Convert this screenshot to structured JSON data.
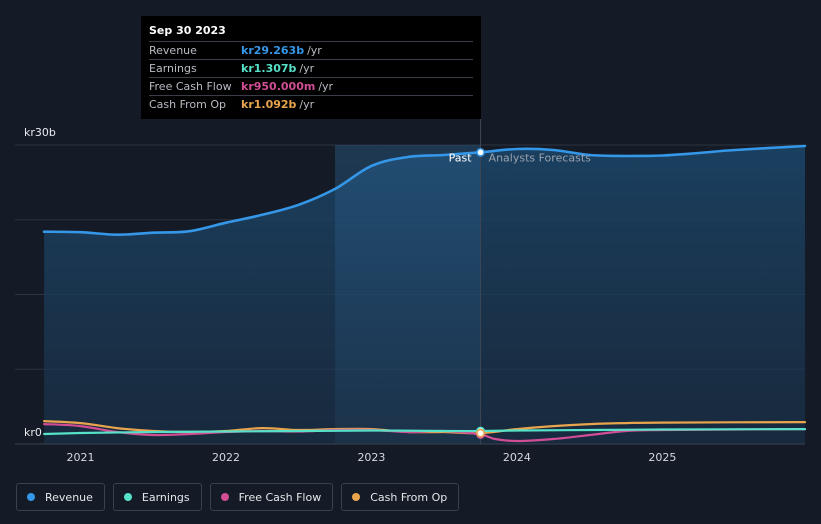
{
  "chart_data": {
    "type": "line",
    "currency_prefix": "kr",
    "y_axis": {
      "top_label": "kr30b",
      "bottom_label": "kr0",
      "ylim": [
        0,
        30
      ]
    },
    "x_ticks": [
      "2021",
      "2022",
      "2023",
      "2024",
      "2025"
    ],
    "x_tick_values": [
      2021.0,
      2022.0,
      2023.0,
      2024.0,
      2025.0
    ],
    "xlim": [
      2020.55,
      2025.98
    ],
    "past_end": 2023.75,
    "shade_start": 2022.75,
    "divider_labels": {
      "past": "Past",
      "forecast": "Analysts Forecasts"
    },
    "series": [
      {
        "name": "Revenue",
        "color": "#3597e8",
        "fill": true,
        "points": [
          [
            2020.75,
            21.3
          ],
          [
            2021.0,
            21.25
          ],
          [
            2021.25,
            21.0
          ],
          [
            2021.5,
            21.2
          ],
          [
            2021.75,
            21.35
          ],
          [
            2022.0,
            22.2
          ],
          [
            2022.25,
            23.0
          ],
          [
            2022.5,
            24.0
          ],
          [
            2022.75,
            25.6
          ],
          [
            2023.0,
            27.9
          ],
          [
            2023.25,
            28.8
          ],
          [
            2023.5,
            29.0
          ],
          [
            2023.75,
            29.263
          ],
          [
            2024.0,
            29.6
          ],
          [
            2024.25,
            29.5
          ],
          [
            2024.5,
            29.0
          ],
          [
            2024.75,
            28.9
          ],
          [
            2025.0,
            28.95
          ],
          [
            2025.25,
            29.2
          ],
          [
            2025.5,
            29.5
          ],
          [
            2025.98,
            29.9
          ]
        ]
      },
      {
        "name": "Earnings",
        "color": "#57e1c8",
        "fill": false,
        "points": [
          [
            2020.75,
            1.0
          ],
          [
            2021.0,
            1.1
          ],
          [
            2021.5,
            1.2
          ],
          [
            2022.0,
            1.25
          ],
          [
            2022.5,
            1.3
          ],
          [
            2023.0,
            1.35
          ],
          [
            2023.5,
            1.3
          ],
          [
            2023.75,
            1.307
          ],
          [
            2024.0,
            1.35
          ],
          [
            2024.5,
            1.4
          ],
          [
            2025.0,
            1.45
          ],
          [
            2025.98,
            1.5
          ]
        ]
      },
      {
        "name": "Free Cash Flow",
        "color": "#d14e94",
        "fill": false,
        "points": [
          [
            2020.75,
            2.0
          ],
          [
            2021.0,
            1.8
          ],
          [
            2021.25,
            1.2
          ],
          [
            2021.5,
            0.9
          ],
          [
            2021.75,
            1.0
          ],
          [
            2022.0,
            1.2
          ],
          [
            2022.25,
            1.3
          ],
          [
            2022.5,
            1.25
          ],
          [
            2022.75,
            1.4
          ],
          [
            2023.0,
            1.4
          ],
          [
            2023.25,
            1.2
          ],
          [
            2023.5,
            1.3
          ],
          [
            2023.75,
            0.95
          ],
          [
            2023.85,
            0.5
          ],
          [
            2024.0,
            0.3
          ],
          [
            2024.25,
            0.5
          ],
          [
            2024.5,
            0.9
          ],
          [
            2024.75,
            1.3
          ],
          [
            2025.0,
            1.4
          ],
          [
            2025.98,
            1.5
          ]
        ]
      },
      {
        "name": "Cash From Op",
        "color": "#e9a54d",
        "fill": false,
        "points": [
          [
            2020.75,
            2.3
          ],
          [
            2021.0,
            2.1
          ],
          [
            2021.25,
            1.6
          ],
          [
            2021.5,
            1.3
          ],
          [
            2021.75,
            1.2
          ],
          [
            2022.0,
            1.3
          ],
          [
            2022.25,
            1.6
          ],
          [
            2022.5,
            1.4
          ],
          [
            2022.75,
            1.5
          ],
          [
            2023.0,
            1.5
          ],
          [
            2023.25,
            1.2
          ],
          [
            2023.5,
            1.2
          ],
          [
            2023.75,
            1.092
          ],
          [
            2024.0,
            1.5
          ],
          [
            2024.25,
            1.8
          ],
          [
            2024.5,
            2.0
          ],
          [
            2024.75,
            2.1
          ],
          [
            2025.0,
            2.15
          ],
          [
            2025.98,
            2.2
          ]
        ]
      }
    ]
  },
  "tooltip": {
    "date": "Sep 30 2023",
    "rows": [
      {
        "name": "Revenue",
        "value": "kr29.263b",
        "unit": "/yr",
        "color": "#3597e8"
      },
      {
        "name": "Earnings",
        "value": "kr1.307b",
        "unit": "/yr",
        "color": "#57e1c8"
      },
      {
        "name": "Free Cash Flow",
        "value": "kr950.000m",
        "unit": "/yr",
        "color": "#d14e94"
      },
      {
        "name": "Cash From Op",
        "value": "kr1.092b",
        "unit": "/yr",
        "color": "#e9a54d"
      }
    ]
  },
  "legend": [
    {
      "label": "Revenue",
      "color": "#3597e8"
    },
    {
      "label": "Earnings",
      "color": "#57e1c8"
    },
    {
      "label": "Free Cash Flow",
      "color": "#d14e94"
    },
    {
      "label": "Cash From Op",
      "color": "#e9a54d"
    }
  ]
}
